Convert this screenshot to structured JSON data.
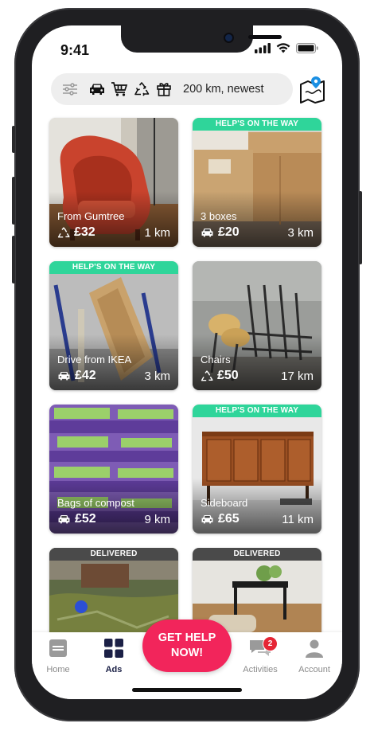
{
  "status": {
    "time": "9:41"
  },
  "filter": {
    "label": "200 km, newest"
  },
  "colors": {
    "banner_help": "#2fd59a",
    "banner_delivered": "#4a4a4a",
    "accent": "#f2255b",
    "nav_active": "#1b2046"
  },
  "cards": [
    {
      "title": "From Gumtree",
      "price": "£32",
      "distance": "1 km",
      "type_icon": "recycle-icon",
      "banner": ""
    },
    {
      "title": "3 boxes",
      "price": "£20",
      "distance": "3 km",
      "type_icon": "car-icon",
      "banner": "HELP'S ON THE WAY"
    },
    {
      "title": "Drive from IKEA",
      "price": "£42",
      "distance": "3 km",
      "type_icon": "car-icon",
      "banner": "HELP'S ON THE WAY"
    },
    {
      "title": "Chairs",
      "price": "£50",
      "distance": "17 km",
      "type_icon": "recycle-icon",
      "banner": ""
    },
    {
      "title": "Bags of compost",
      "price": "£52",
      "distance": "9 km",
      "type_icon": "car-icon",
      "banner": ""
    },
    {
      "title": "Sideboard",
      "price": "£65",
      "distance": "11 km",
      "type_icon": "car-icon",
      "banner": "HELP'S ON THE WAY"
    },
    {
      "title": "",
      "price": "",
      "distance": "",
      "type_icon": "",
      "banner": "DELIVERED"
    },
    {
      "title": "",
      "price": "",
      "distance": "",
      "type_icon": "",
      "banner": "DELIVERED"
    }
  ],
  "nav": {
    "home": "Home",
    "ads": "Ads",
    "help_line1": "GET HELP",
    "help_line2": "NOW!",
    "activities": "Activities",
    "activities_badge": "2",
    "account": "Account"
  }
}
